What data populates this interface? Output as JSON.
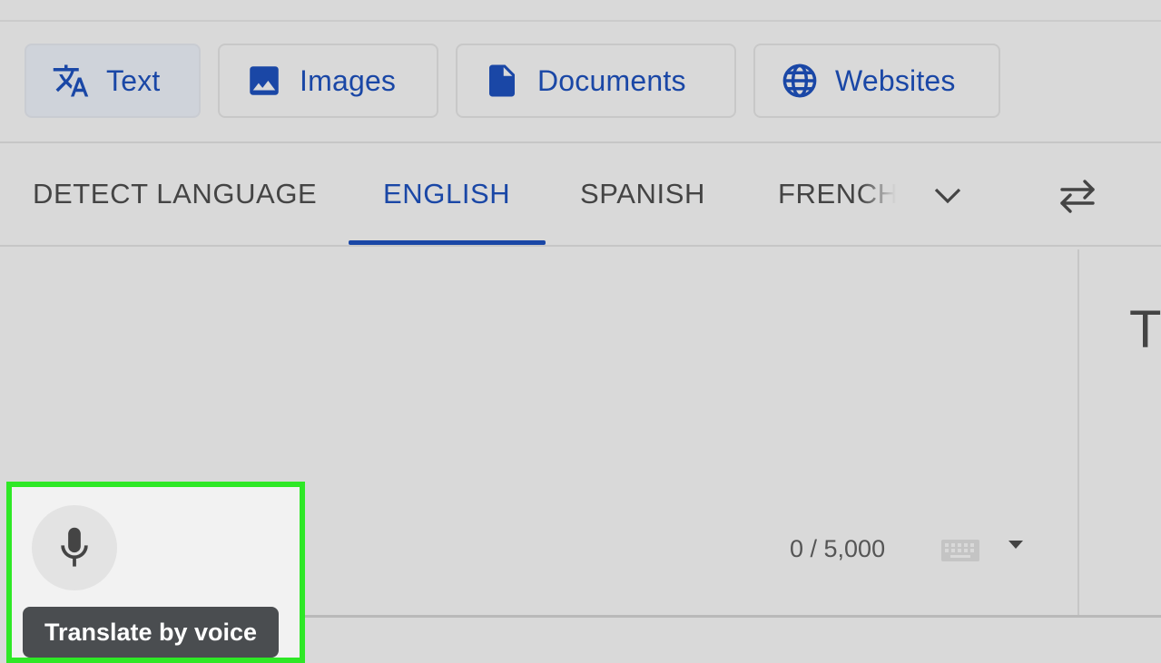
{
  "modes": [
    {
      "label": "Text",
      "icon": "translate-icon",
      "active": true
    },
    {
      "label": "Images",
      "icon": "image-icon",
      "active": false
    },
    {
      "label": "Documents",
      "icon": "document-icon",
      "active": false
    },
    {
      "label": "Websites",
      "icon": "globe-icon",
      "active": false
    }
  ],
  "languages": {
    "tabs": [
      "DETECT LANGUAGE",
      "ENGLISH",
      "SPANISH",
      "FRENCH"
    ],
    "selected": "ENGLISH",
    "more_icon": "chevron-down-icon",
    "swap_icon": "swap-languages-icon"
  },
  "target_panel": {
    "text": "T"
  },
  "source_panel": {
    "char_count": "0 / 5,000",
    "keyboard_icon": "keyboard-icon",
    "input_tools_icon": "caret-down-icon",
    "mic_icon": "microphone-icon",
    "tooltip": "Translate by voice"
  },
  "colors": {
    "accent": "#1a47a6",
    "highlight": "#2ee826",
    "tooltip_bg": "#4a4d50"
  }
}
